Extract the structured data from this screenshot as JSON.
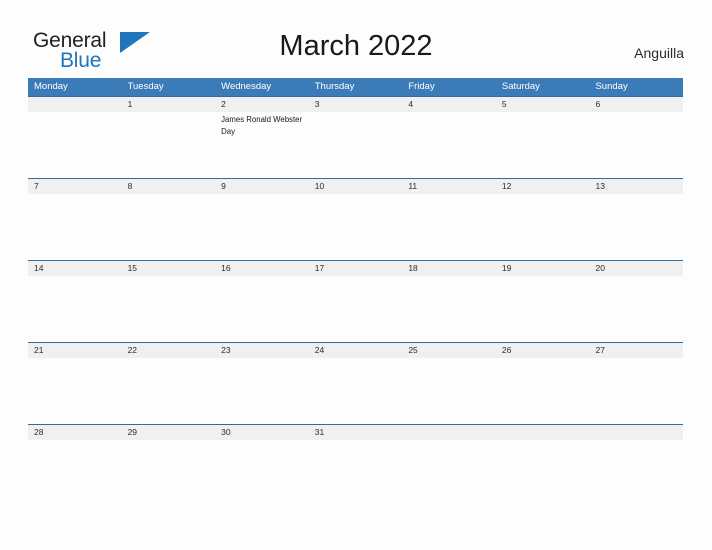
{
  "brand": {
    "name_part1": "General",
    "name_part2": "Blue",
    "flag_icon": "flag-triangle-icon",
    "flag_color": "#1f76bc"
  },
  "header": {
    "title": "March 2022",
    "region": "Anguilla"
  },
  "colors": {
    "header_blue": "#3b7cb8",
    "row_divider_blue": "#2e6da4",
    "date_band_gray": "#f0f0f0",
    "page_background": "#fdfdfd",
    "text_dark": "#2b2b2b",
    "logo_blue": "#1f76bc"
  },
  "calendar": {
    "month": "March",
    "year": "2022",
    "weekdays": [
      "Monday",
      "Tuesday",
      "Wednesday",
      "Thursday",
      "Friday",
      "Saturday",
      "Sunday"
    ],
    "weeks": [
      {
        "days": [
          {
            "num": "",
            "event": ""
          },
          {
            "num": "1",
            "event": ""
          },
          {
            "num": "2",
            "event": "James Ronald Webster Day"
          },
          {
            "num": "3",
            "event": ""
          },
          {
            "num": "4",
            "event": ""
          },
          {
            "num": "5",
            "event": ""
          },
          {
            "num": "6",
            "event": ""
          }
        ]
      },
      {
        "days": [
          {
            "num": "7",
            "event": ""
          },
          {
            "num": "8",
            "event": ""
          },
          {
            "num": "9",
            "event": ""
          },
          {
            "num": "10",
            "event": ""
          },
          {
            "num": "11",
            "event": ""
          },
          {
            "num": "12",
            "event": ""
          },
          {
            "num": "13",
            "event": ""
          }
        ]
      },
      {
        "days": [
          {
            "num": "14",
            "event": ""
          },
          {
            "num": "15",
            "event": ""
          },
          {
            "num": "16",
            "event": ""
          },
          {
            "num": "17",
            "event": ""
          },
          {
            "num": "18",
            "event": ""
          },
          {
            "num": "19",
            "event": ""
          },
          {
            "num": "20",
            "event": ""
          }
        ]
      },
      {
        "days": [
          {
            "num": "21",
            "event": ""
          },
          {
            "num": "22",
            "event": ""
          },
          {
            "num": "23",
            "event": ""
          },
          {
            "num": "24",
            "event": ""
          },
          {
            "num": "25",
            "event": ""
          },
          {
            "num": "26",
            "event": ""
          },
          {
            "num": "27",
            "event": ""
          }
        ]
      },
      {
        "days": [
          {
            "num": "28",
            "event": ""
          },
          {
            "num": "29",
            "event": ""
          },
          {
            "num": "30",
            "event": ""
          },
          {
            "num": "31",
            "event": ""
          },
          {
            "num": "",
            "event": ""
          },
          {
            "num": "",
            "event": ""
          },
          {
            "num": "",
            "event": ""
          }
        ]
      }
    ]
  }
}
